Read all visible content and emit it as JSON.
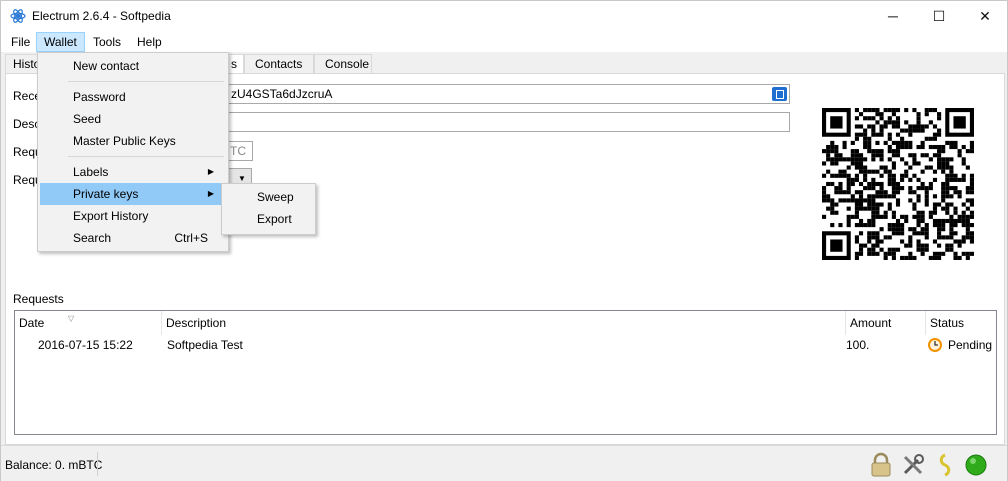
{
  "window": {
    "title": "Electrum 2.6.4  -  Softpedia"
  },
  "titlebar_buttons": [
    "─",
    "☐",
    "✕"
  ],
  "menubar": [
    {
      "label": "File"
    },
    {
      "label": "Wallet"
    },
    {
      "label": "Tools"
    },
    {
      "label": "Help"
    }
  ],
  "tabs": [
    {
      "label": "Histo"
    },
    {
      "label": "s"
    },
    {
      "label": "Contacts"
    },
    {
      "label": "Console"
    }
  ],
  "form": {
    "label_receive": "Rece",
    "address_value": "zU4GSTa6dJzcruA",
    "label_description": "Desc",
    "label_amount": "Requ",
    "amount_unit": "TC",
    "label_expires": "Requ"
  },
  "requests": {
    "section_label": "Requests",
    "columns": [
      "Date",
      "Description",
      "Amount",
      "Status"
    ],
    "rows": [
      {
        "date": "2016-07-15 15:22",
        "description": "Softpedia Test",
        "amount": "100.",
        "status": "Pending"
      }
    ]
  },
  "wallet_menu": {
    "items": [
      {
        "label": "New contact"
      },
      {
        "label": "Password"
      },
      {
        "label": "Seed"
      },
      {
        "label": "Master Public Keys"
      },
      {
        "label": "Labels"
      },
      {
        "label": "Private keys"
      },
      {
        "label": "Export History"
      },
      {
        "label": "Search",
        "shortcut": "Ctrl+S"
      }
    ],
    "submenu": [
      {
        "label": "Sweep"
      },
      {
        "label": "Export"
      }
    ]
  },
  "status_bar": {
    "balance": "Balance: 0. mBTC",
    "icons": [
      "lock-icon",
      "preferences-icon",
      "seed-icon",
      "network-status-icon"
    ]
  },
  "colors": {
    "menu_highlight": "#91c9f7",
    "status_pending": "#f29200",
    "network_ok": "#2eaa1b"
  }
}
